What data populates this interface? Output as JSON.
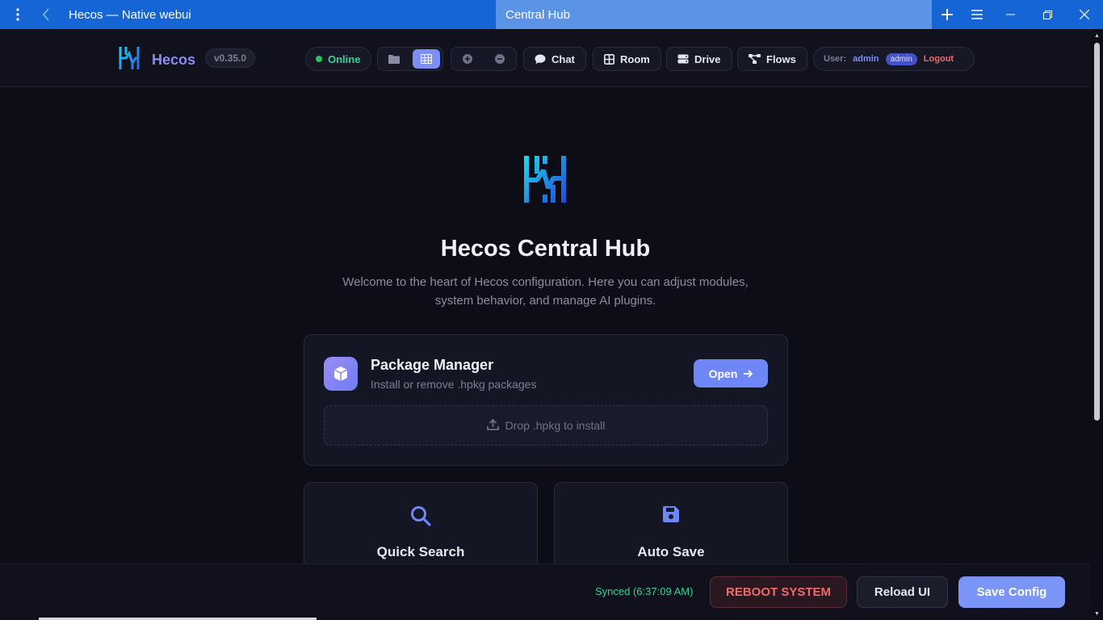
{
  "browser": {
    "tab1_title": "Hecos — Native webui",
    "tab2_title": "Central Hub"
  },
  "header": {
    "brand": "Hecos",
    "version": "v0.35.0",
    "status": "Online",
    "nav": {
      "chat": "Chat",
      "room": "Room",
      "drive": "Drive",
      "flows": "Flows"
    },
    "user": {
      "label": "User:",
      "name": "admin",
      "role": "admin",
      "logout": "Logout"
    }
  },
  "hero": {
    "title": "Hecos Central Hub",
    "subtitle": "Welcome to the heart of Hecos configuration. Here you can adjust modules, system behavior, and manage AI plugins."
  },
  "package_manager": {
    "title": "Package Manager",
    "description": "Install or remove .hpkg packages",
    "open_label": "Open",
    "dropzone_label": "Drop .hpkg to install"
  },
  "features": [
    {
      "title": "Quick Search",
      "icon": "search-icon"
    },
    {
      "title": "Auto Save",
      "icon": "floppy-disk-icon"
    }
  ],
  "footer": {
    "sync_status": "Synced (6:37:09 AM)",
    "reboot_label": "REBOOT SYSTEM",
    "reload_label": "Reload UI",
    "save_label": "Save Config"
  },
  "colors": {
    "accent": "#7b8ff6",
    "online": "#34d399",
    "danger": "#ef6b6b",
    "background": "#0c0d16"
  }
}
